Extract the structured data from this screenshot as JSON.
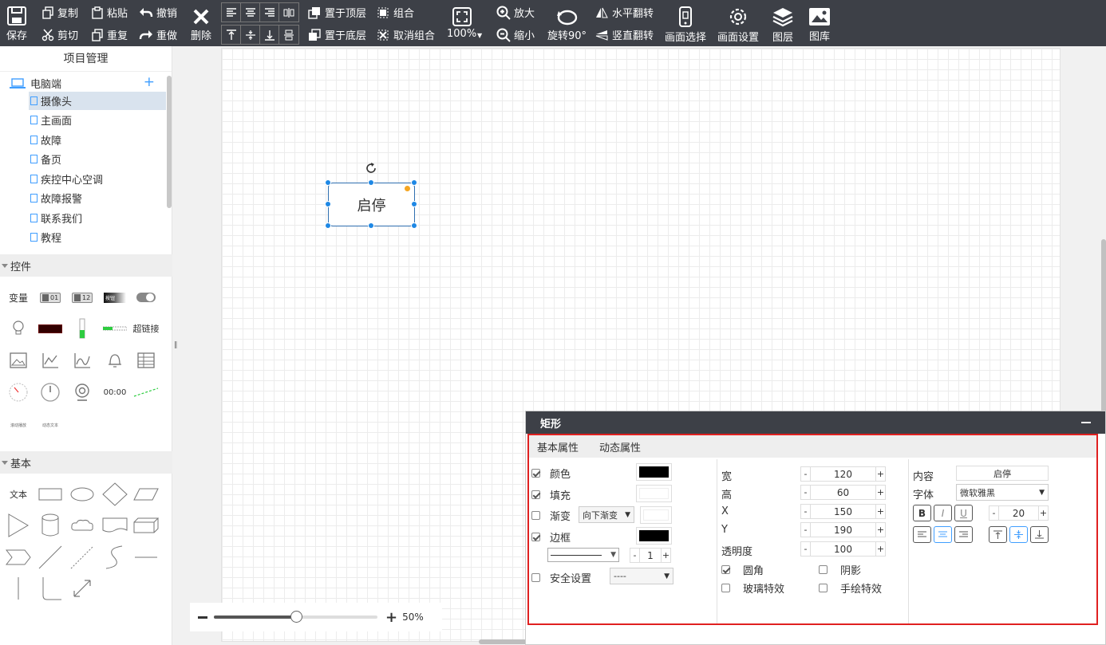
{
  "toolbar": {
    "save": "保存",
    "copy": "复制",
    "paste": "粘贴",
    "undo": "撤销",
    "cut": "剪切",
    "duplicate": "重复",
    "redo": "重做",
    "delete": "删除",
    "bring_top": "置于顶层",
    "send_bottom": "置于底层",
    "group": "组合",
    "ungroup": "取消组合",
    "zoom_level": "100%",
    "zoom_in": "放大",
    "zoom_out": "缩小",
    "rotate": "旋转90°",
    "flip_h": "水平翻转",
    "flip_v": "竖直翻转",
    "canvas_select": "画面选择",
    "canvas_settings": "画面设置",
    "layers": "图层",
    "gallery": "图库"
  },
  "project": {
    "title": "项目管理",
    "root": "电脑端",
    "pages": [
      "摄像头",
      "主画面",
      "故障",
      "备页",
      "疾控中心空调",
      "故障报警",
      "联系我们",
      "教程"
    ],
    "selected_index": 0
  },
  "controls": {
    "title": "控件",
    "variable": "变量",
    "hyperlink": "超链接",
    "toggle_01": "01",
    "toggle_12": "12",
    "button_text": "按钮",
    "clock": "00:00",
    "small_1": "滚动播放",
    "small_2": "动态文本"
  },
  "basic": {
    "title": "基本",
    "text": "文本"
  },
  "canvas": {
    "shape_text": "启停"
  },
  "zoom": {
    "value": "50%",
    "level_fraction": 0.5
  },
  "panel": {
    "title": "矩形",
    "tab_basic": "基本属性",
    "tab_dynamic": "动态属性",
    "color": "颜色",
    "fill": "填充",
    "gradient": "渐变",
    "gradient_dir": "向下渐变",
    "border": "边框",
    "border_width": "1",
    "security": "安全设置",
    "security_value": "----",
    "width_label": "宽",
    "width": "120",
    "height_label": "高",
    "height": "60",
    "x_label": "X",
    "x": "150",
    "y_label": "Y",
    "y": "190",
    "opacity_label": "透明度",
    "opacity": "100",
    "rounded": "圆角",
    "shadow": "阴影",
    "glass": "玻璃特效",
    "handdrawn": "手绘特效",
    "content_label": "内容",
    "content": "启停",
    "font_label": "字体",
    "font": "微软雅黑",
    "font_size": "20",
    "bold": "B",
    "italic": "I",
    "underline": "U",
    "color_value": "#000000",
    "fill_value": "#ffffff",
    "border_value": "#000000"
  }
}
